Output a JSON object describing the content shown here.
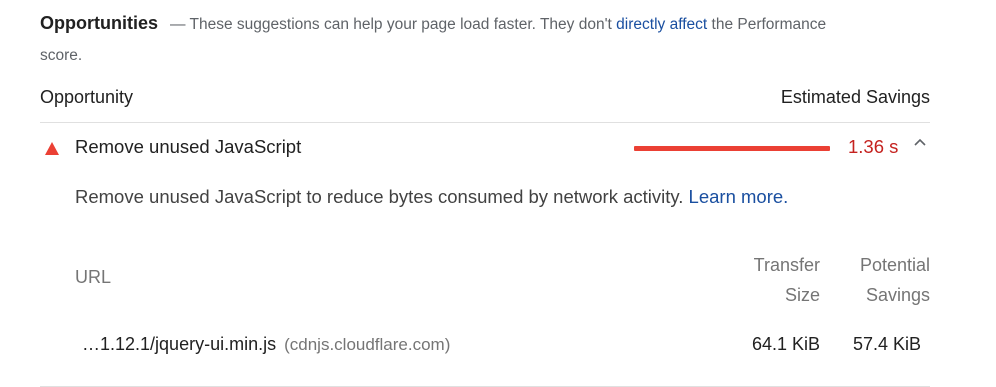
{
  "section": {
    "title": "Opportunities",
    "dash": "—",
    "description_pre": "These suggestions can help your page load faster. They don't",
    "link_text": "directly affect",
    "description_post": "the Performance score."
  },
  "columns": {
    "opportunity": "Opportunity",
    "estimated_savings": "Estimated Savings"
  },
  "audit": {
    "status_icon": "fail-triangle-icon",
    "title": "Remove unused JavaScript",
    "savings": "1.36 s",
    "savings_bar_fraction": 1.0,
    "expanded": true,
    "status_color": "#eb4034",
    "description": "Remove unused JavaScript to reduce bytes consumed by network activity.",
    "learn_more": "Learn more.",
    "table": {
      "headers": {
        "url": "URL",
        "transfer_size_line1": "Transfer",
        "transfer_size_line2": "Size",
        "potential_savings_line1": "Potential",
        "potential_savings_line2": "Savings"
      },
      "rows": [
        {
          "url": "…1.12.1/jquery-ui.min.js",
          "origin": "(cdnjs.cloudflare.com)",
          "transfer_size": "64.1 KiB",
          "potential_savings": "57.4 KiB"
        }
      ]
    }
  },
  "colors": {
    "fail": "#eb4034",
    "fail_text": "#c5221f",
    "link": "#1a4fa0"
  }
}
